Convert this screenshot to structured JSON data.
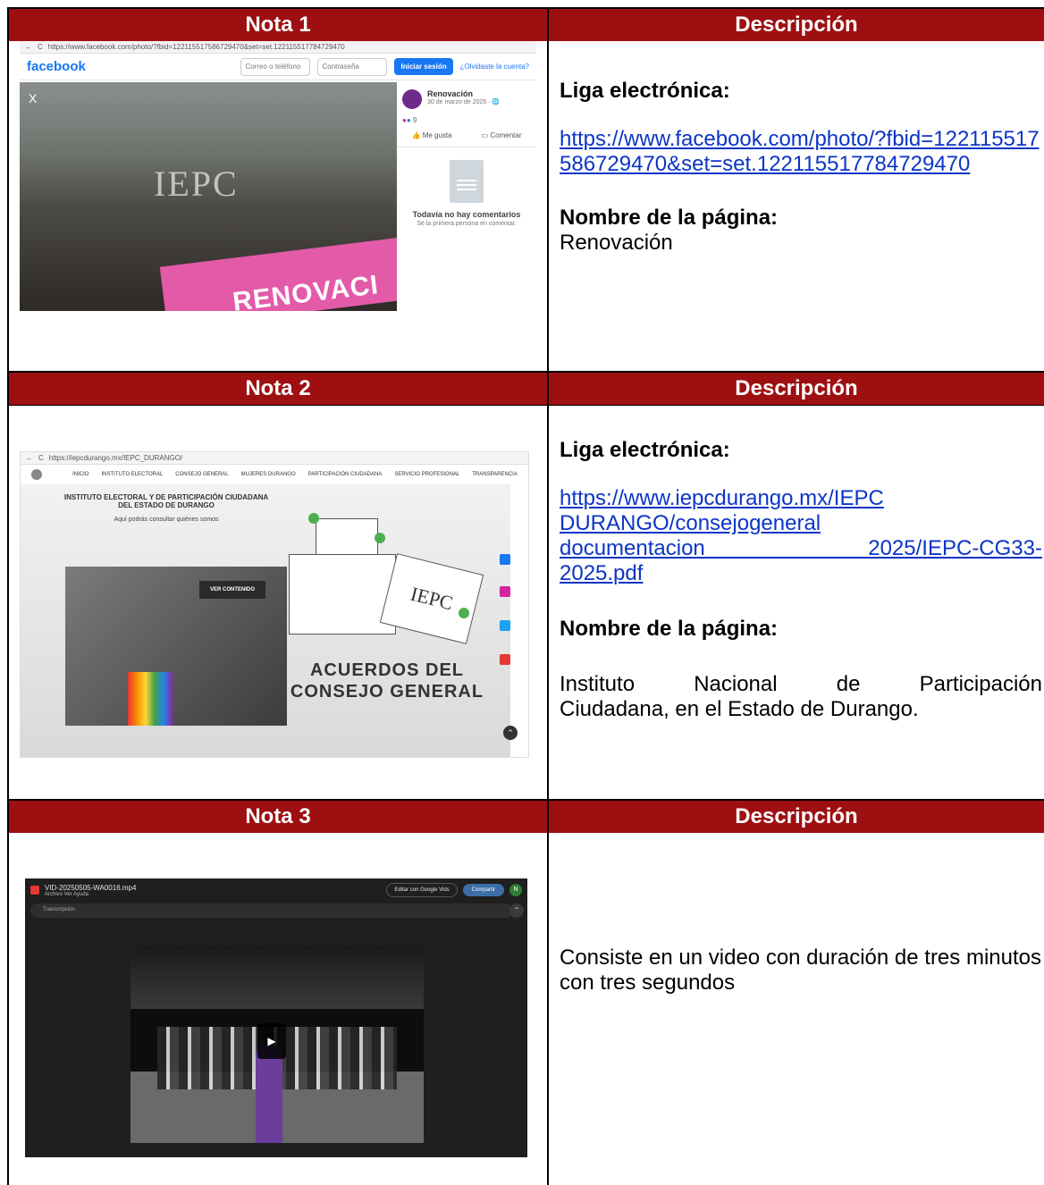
{
  "rows": [
    {
      "nota_header": "Nota 1",
      "desc_header": "Descripción",
      "liga_label": "Liga electrónica:",
      "liga_url": "https://www.facebook.com/photo/?fbid=122115517586729470&set=set.122115517784729470",
      "pagina_label": "Nombre de la página:",
      "pagina_value": "Renovación",
      "screenshot": {
        "address": "https://www.facebook.com/photo/?fbid=122115517586729470&set=set.122115517784729470",
        "brand": "facebook",
        "login_email_placeholder": "Correo o teléfono",
        "login_password_placeholder": "Contraseña",
        "login_button": "Iniciar sesión",
        "forgot_link": "¿Olvidaste la cuenta?",
        "close": "X",
        "photo_wall_text": "IEPC",
        "banner_text": "RENOVACI",
        "page_name": "Renovación",
        "post_date": "30 de marzo de 2025 · 🌐",
        "reactions_count": "9",
        "like_label": "Me gusta",
        "comment_label": "Comentar",
        "no_comments": "Todavía no hay comentarios",
        "be_first": "Sé la primera persona en comentar."
      }
    },
    {
      "nota_header": "Nota 2",
      "desc_header": "Descripción",
      "liga_label": "Liga electrónica:",
      "liga_line1": "https://www.iepcdurango.mx/IEPC",
      "liga_line2": "DURANGO/consejogeneral",
      "liga_line3": "documentacion 2025/IEPC-CG33-",
      "liga_line4": "2025.pdf",
      "pagina_label": "Nombre de la página:",
      "pagina_line1": "Instituto Nacional de Participación",
      "pagina_line2": "Ciudadana, en el Estado de Durango.",
      "screenshot": {
        "address": "https://iepcdurango.mx/IEPC_DURANGO/",
        "nav": [
          "INICIO",
          "INSTITUTO ELECTORAL",
          "CONSEJO GENERAL",
          "MUJERES DURANGO",
          "PARTICIPACIÓN CIUDADANA",
          "SERVICIO PROFESIONAL",
          "TRANSPARENCIA"
        ],
        "institute": "INSTITUTO ELECTORAL Y DE PARTICIPACIÓN CIUDADANA DEL ESTADO DE DURANGO",
        "subtitle": "Aquí podrás consultar quiénes somos",
        "ver_button": "VER CONTENIDO",
        "doc_logo": "IEPC",
        "headline_1": "ACUERDOS DEL",
        "headline_2": "CONSEJO GENERAL"
      }
    },
    {
      "nota_header": "Nota 3",
      "desc_header": "Descripción",
      "description": "Consiste en un video con duración de tres minutos con tres segundos",
      "screenshot": {
        "file_name": "VID-20250505-WA0016.mp4",
        "menu": "Archivo   Ver   Ayuda",
        "edit_button": "Editar con Google Vids",
        "share_button": "Compartir",
        "user_initial": "N",
        "transcription": "Transcripción"
      }
    }
  ],
  "colors": {
    "header_bg": "#9e0f12",
    "link": "#0b35c6",
    "facebook_blue": "#1877f2"
  }
}
